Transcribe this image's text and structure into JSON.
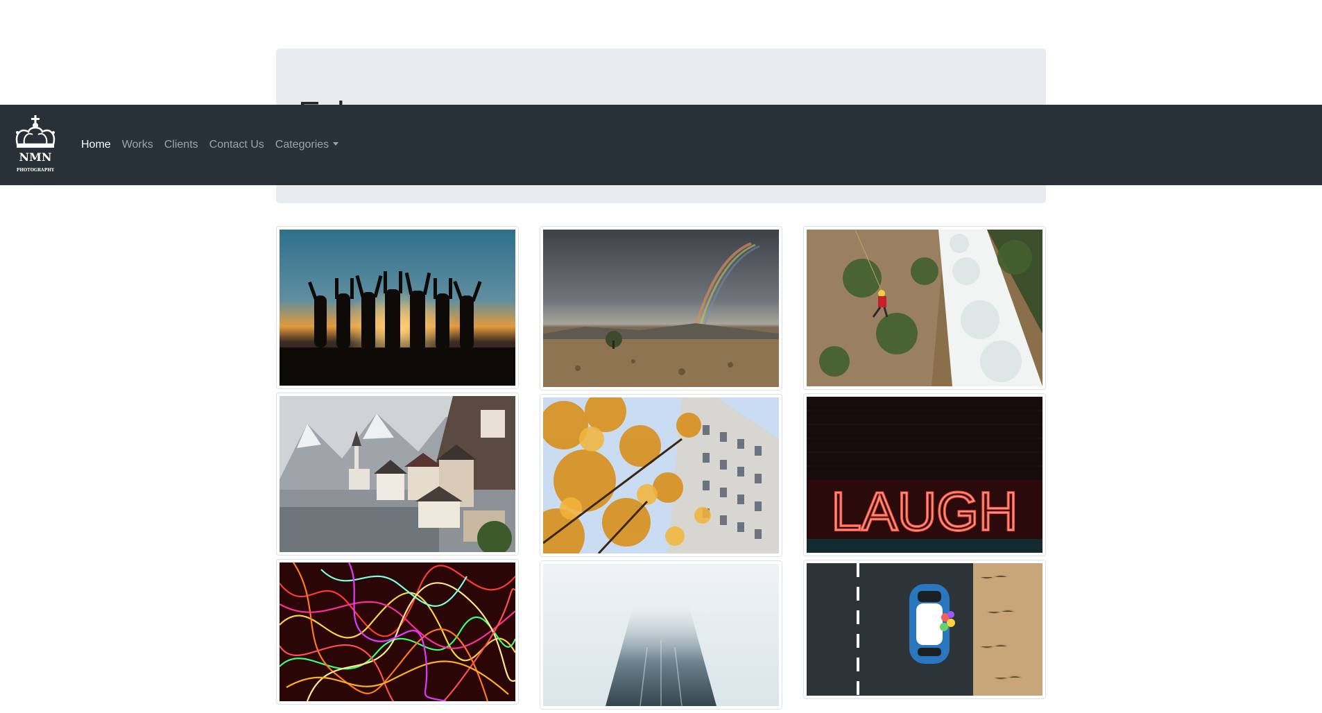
{
  "brand": {
    "logo_text": "NMN",
    "logo_subtext": "PHOTOGRAPHY"
  },
  "nav": {
    "items": [
      "Home",
      "Works",
      "Clients",
      "Contact Us",
      "Categories"
    ],
    "active": "Home"
  },
  "jumbotron": {
    "title_visible_fragment": "Exl"
  },
  "gallery": {
    "images": [
      "sunset-silhouettes-photo",
      "rainbow-landscape-photo",
      "waterfall-climber-photo",
      "lakeside-village-photo",
      "autumn-building-photo",
      "neon-laugh-sign-photo",
      "light-trails-photo",
      "foggy-skyscraper-photo",
      "car-top-view-photo"
    ],
    "neon_sign_text": "LAUGH"
  },
  "colors": {
    "navbar": "#283138",
    "jumbotron": "#e9ecef",
    "nav_link": "rgba(255,255,255,0.55)",
    "nav_active": "#ffffff"
  }
}
